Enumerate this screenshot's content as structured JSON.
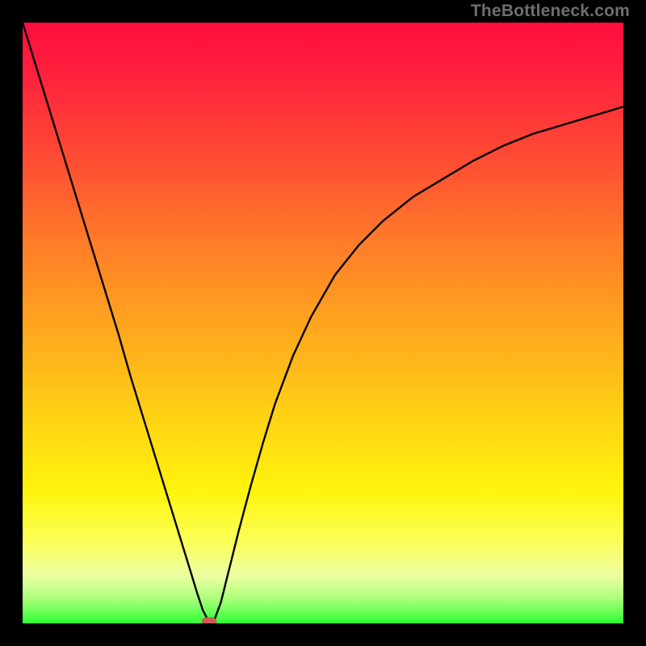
{
  "watermark": "TheBottleneck.com",
  "gradient_colors": {
    "top": "#ff0d3f",
    "mid_upper": "#ff7a29",
    "mid": "#ffcd15",
    "mid_lower": "#fff40c",
    "bottom": "#2dff34"
  },
  "chart_data": {
    "type": "line",
    "title": "",
    "xlabel": "",
    "ylabel": "",
    "xlim": [
      0,
      100
    ],
    "ylim": [
      0,
      100
    ],
    "x": [
      0,
      2,
      4,
      6,
      8,
      10,
      12,
      14,
      16,
      18,
      20,
      22,
      24,
      26,
      28,
      29,
      30,
      31,
      32,
      33,
      34,
      36,
      38,
      40,
      42,
      45,
      48,
      52,
      56,
      60,
      65,
      70,
      75,
      80,
      85,
      90,
      95,
      100
    ],
    "values": [
      100,
      93.5,
      87,
      80.5,
      74,
      67.5,
      61,
      54.5,
      48,
      41,
      34.5,
      28,
      21.5,
      15,
      8.5,
      5.2,
      2.2,
      0.3,
      0.8,
      3.5,
      7.5,
      15.5,
      23,
      30,
      36.5,
      44.5,
      51,
      58,
      63,
      67,
      71,
      74,
      77,
      79.5,
      81.5,
      83,
      84.5,
      86
    ],
    "marker": {
      "x": 31,
      "y": 0.3,
      "color": "#d05a5a"
    },
    "grid": false,
    "legend": false
  }
}
